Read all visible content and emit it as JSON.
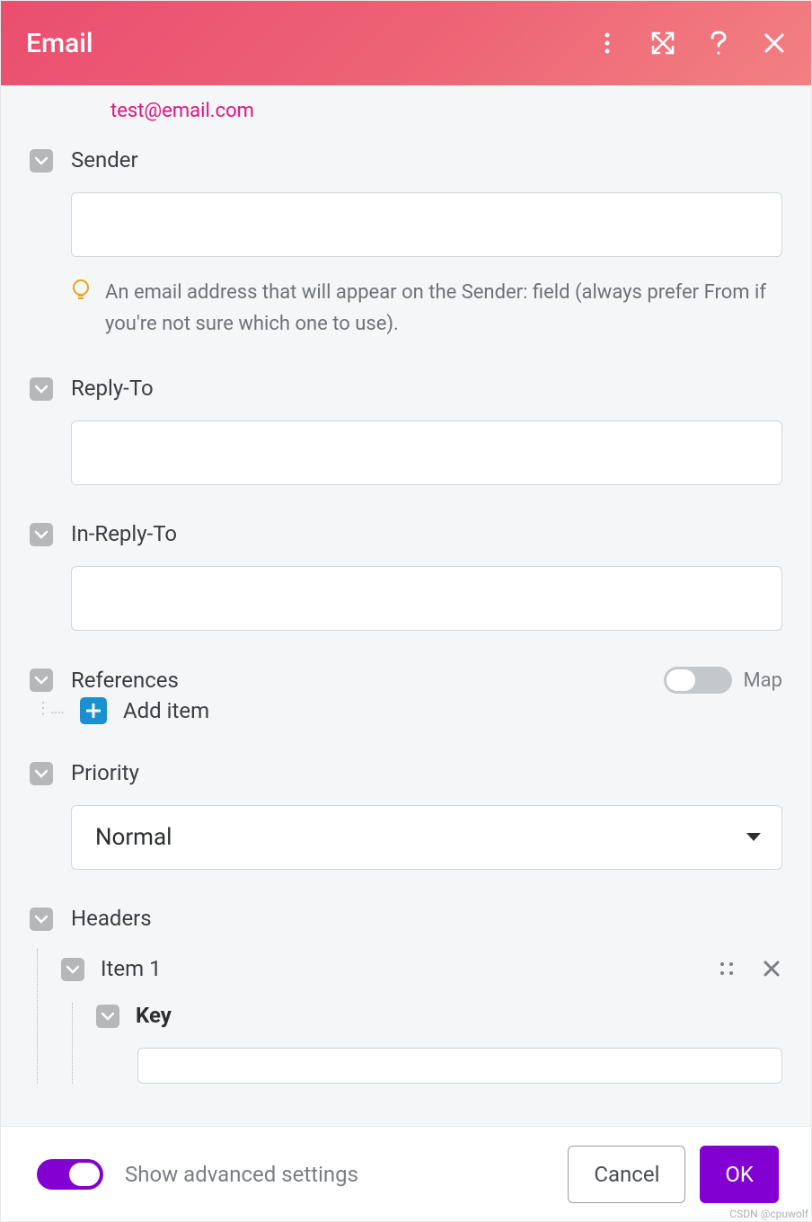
{
  "header": {
    "title": "Email"
  },
  "pre": {
    "email": "test@email.com"
  },
  "fields": {
    "sender": {
      "label": "Sender",
      "value": "",
      "hint": "An email address that will appear on the Sender: field (always prefer From if you're not sure which one to use)."
    },
    "replyTo": {
      "label": "Reply-To",
      "value": ""
    },
    "inReplyTo": {
      "label": "In-Reply-To",
      "value": ""
    },
    "references": {
      "label": "References",
      "mapLabel": "Map",
      "addItemLabel": "Add item"
    },
    "priority": {
      "label": "Priority",
      "value": "Normal"
    },
    "headers": {
      "label": "Headers",
      "item1": {
        "title": "Item 1",
        "keyLabel": "Key",
        "keyValue": ""
      }
    }
  },
  "footer": {
    "advancedLabel": "Show advanced settings",
    "cancel": "Cancel",
    "ok": "OK"
  },
  "watermark": "CSDN @cpuwolf"
}
